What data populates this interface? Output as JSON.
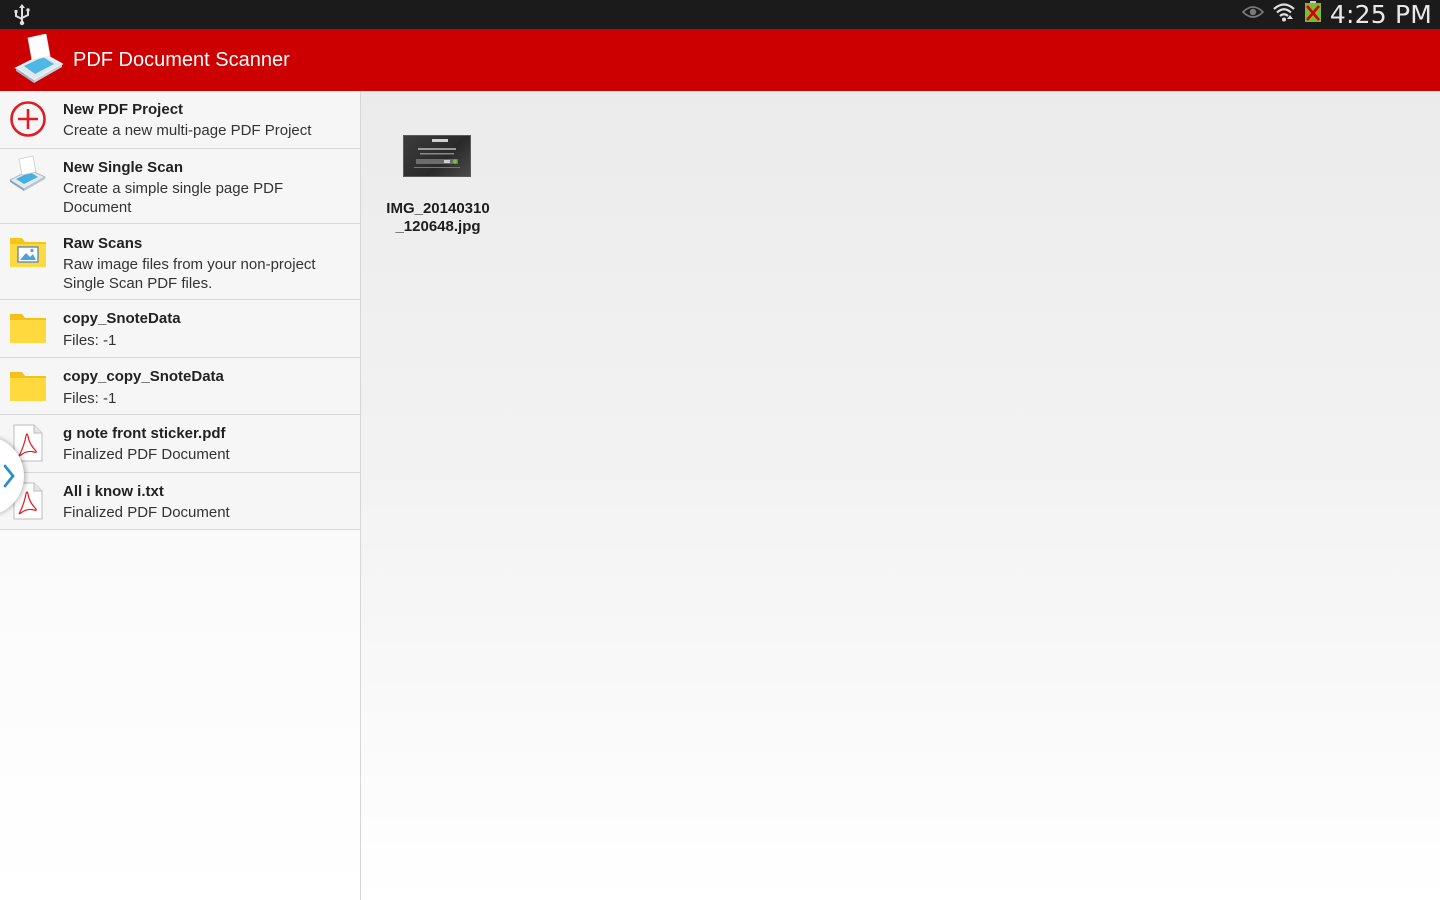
{
  "status_bar": {
    "time": "4:25 PM",
    "icons": [
      "usb-icon",
      "eye-icon",
      "wifi-icon",
      "battery-icon"
    ]
  },
  "action_bar": {
    "title": "PDF Document Scanner",
    "logo_icon": "scanner-logo-icon"
  },
  "sidebar": {
    "items": [
      {
        "title": "New PDF Project",
        "subtitle": "Create a new multi-page PDF Project",
        "icon": "add-circle-icon"
      },
      {
        "title": "New Single Scan",
        "subtitle": "Create a simple single page PDF Document",
        "icon": "scanner-icon"
      },
      {
        "title": "Raw Scans",
        "subtitle": "Raw image files from your non-project Single Scan PDF files.",
        "icon": "image-folder-icon"
      },
      {
        "title": "copy_SnoteData",
        "subtitle": "Files: -1",
        "icon": "folder-icon"
      },
      {
        "title": "copy_copy_SnoteData",
        "subtitle": "Files: -1",
        "icon": "folder-icon"
      },
      {
        "title": "g note front sticker.pdf",
        "subtitle": "Finalized PDF Document",
        "icon": "pdf-icon"
      },
      {
        "title": "All i know i.txt",
        "subtitle": "Finalized PDF Document",
        "icon": "pdf-icon"
      }
    ]
  },
  "content": {
    "files": [
      {
        "name": "IMG_20140310_120648.jpg"
      }
    ]
  },
  "colors": {
    "action_bar": "#cc0000",
    "status_bar": "#1b1b1b",
    "accent_blue": "#2a8fd0"
  }
}
